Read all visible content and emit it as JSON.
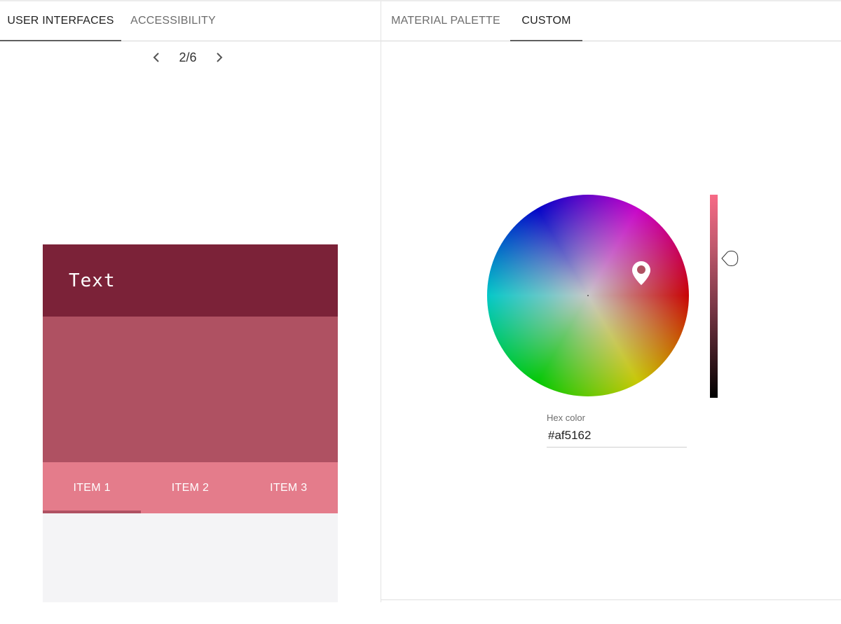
{
  "left_panel": {
    "tabs": [
      {
        "label": "USER INTERFACES",
        "active": true
      },
      {
        "label": "ACCESSIBILITY",
        "active": false
      }
    ],
    "pager": {
      "text": "2/6",
      "prev_icon": "chevron-left-icon",
      "next_icon": "chevron-right-icon"
    },
    "preview": {
      "header_text": "Text",
      "tabs": [
        {
          "label": "ITEM 1",
          "active": true
        },
        {
          "label": "ITEM 2",
          "active": false
        },
        {
          "label": "ITEM 3",
          "active": false
        }
      ],
      "colors": {
        "header": "#7b2238",
        "body": "#af5162",
        "tabs": "#e47c8b",
        "indicator": "#af5162",
        "bottom": "#f4f4f6"
      }
    }
  },
  "right_panel": {
    "tabs": [
      {
        "label": "MATERIAL PALETTE",
        "active": false
      },
      {
        "label": "CUSTOM",
        "active": true
      }
    ],
    "picker": {
      "hex_label": "Hex color",
      "hex_value": "#af5162",
      "marker_icon": "map-pin-icon",
      "slider_handle_icon": "drop-handle-icon"
    }
  }
}
